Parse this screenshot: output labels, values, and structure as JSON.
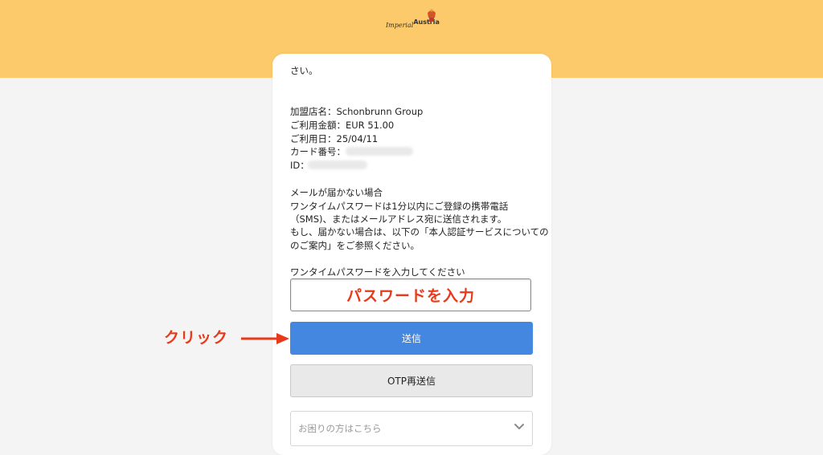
{
  "header": {
    "logo_script": "Imperial",
    "logo_bold": "Austria",
    "background": "#fcc96b"
  },
  "card": {
    "intro_tail": "さい。",
    "transaction": {
      "merchant": "加盟店名：Schonbrunn Group",
      "amount": "ご利用金額：EUR 51.00",
      "date": "ご利用日：25/04/11",
      "card_number_label": "カード番号：",
      "id_label": "ID："
    },
    "notice": {
      "heading": "メールが届かない場合",
      "line1": "ワンタイムパスワードは1分以内にご登録の携帯電話",
      "line2": "（SMS)、またはメールアドレス宛に送信されます。",
      "line3": "もし、届かない場合は、以下の「本人認証サービスについての",
      "line4": "のご案内」をご参照ください。"
    },
    "otp_prompt": "ワンタイムパスワードを入力してください",
    "otp_input": {
      "value": "",
      "placeholder": ""
    },
    "submit_label": "送信",
    "resend_label": "OTP再送信",
    "help_label": "お困りの方はこちら"
  },
  "annotations": {
    "input_hint": "パスワードを入力",
    "click_hint": "クリック",
    "color": "#e8391a"
  },
  "colors": {
    "primary_button": "#4487e0",
    "secondary_button": "#e9e9e9"
  }
}
